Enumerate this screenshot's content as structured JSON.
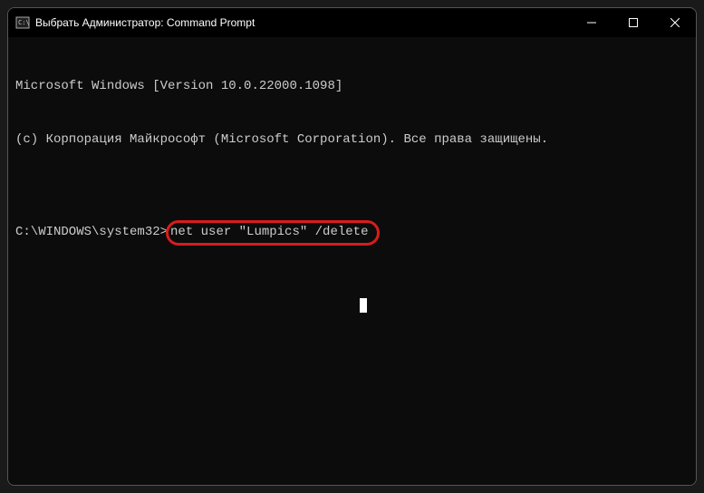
{
  "window": {
    "title": "Выбрать Администратор: Command Prompt"
  },
  "terminal": {
    "line1": "Microsoft Windows [Version 10.0.22000.1098]",
    "line2": "(c) Корпорация Майкрософт (Microsoft Corporation). Все права защищены.",
    "blank": "",
    "prompt": "C:\\WINDOWS\\system32>",
    "command": "net user \"Lumpics\" /delete"
  }
}
